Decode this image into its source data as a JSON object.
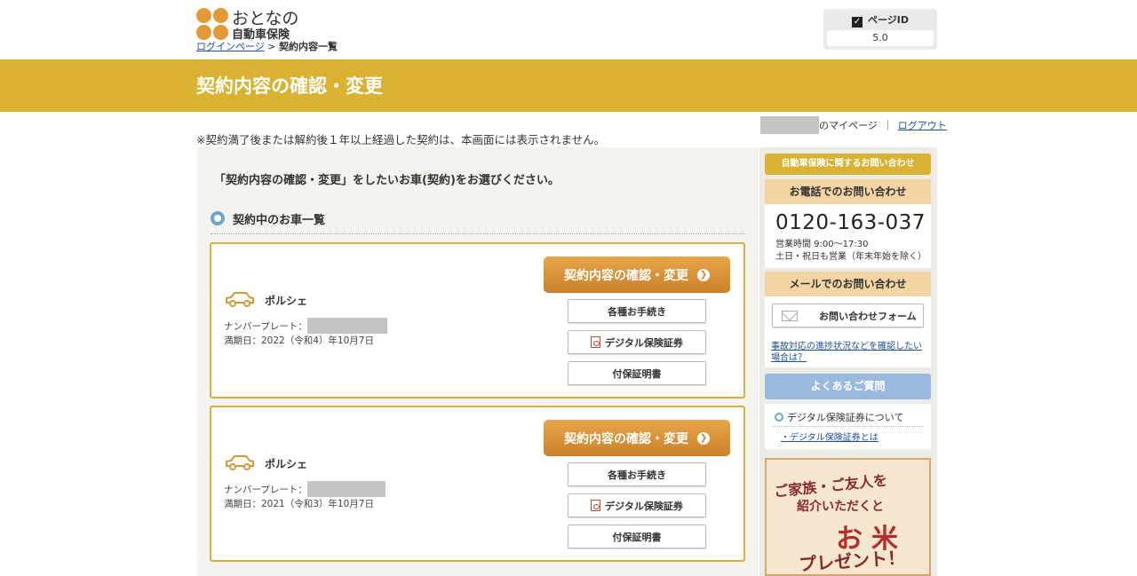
{
  "header": {
    "logo_line1": "おとなの",
    "logo_line2": "自動車保険",
    "breadcrumb_link": "ログインページ",
    "breadcrumb_sep": " > ",
    "breadcrumb_current": "契約内容一覧",
    "page_id_label": "ページID",
    "page_id_value": "5.0"
  },
  "banner": {
    "title": "契約内容の確認・変更"
  },
  "userbar": {
    "mypage_suffix": "のマイページ",
    "separator": "｜",
    "logout": "ログアウト"
  },
  "notice": "※契約満了後または解約後１年以上経過した契約は、本画面には表示されません。",
  "main": {
    "lead": "「契約内容の確認・変更」をしたいお車(契約)をお選びください。",
    "section_title": "契約中のお車一覧",
    "cars": [
      {
        "name": "ポルシェ",
        "plate_label": "ナンバープレート：",
        "expiry": "満期日：2022（令和4）年10月7日",
        "main_button": "契約内容の確認・変更",
        "btn_procedures": "各種お手続き",
        "btn_digital": "デジタル保険証券",
        "btn_certificate": "付保証明書"
      },
      {
        "name": "ポルシェ",
        "plate_label": "ナンバープレート：",
        "expiry": "満期日：2021（令和3）年10月7日",
        "main_button": "契約内容の確認・変更",
        "btn_procedures": "各種お手続き",
        "btn_digital": "デジタル保険証券",
        "btn_certificate": "付保証明書"
      }
    ]
  },
  "sidebar": {
    "contact_title": "自動車保険に関するお問い合わせ",
    "phone_head": "お電話でのお問い合わせ",
    "phone_number": "0120-163-037",
    "hours_line1": "営業時間 9:00～17:30",
    "hours_line2": "土日・祝日も営業（年末年始を除く）",
    "mail_head": "メールでのお問い合わせ",
    "mail_button": "お問い合わせフォーム",
    "accident_link": "事故対応の進捗状況などを確認したい場合は？",
    "faq_button": "よくあるご質問",
    "faq_question": "デジタル保険証券について",
    "faq_answer": "・デジタル保険証券とは",
    "promo_line1": "ご家族・ご友人を",
    "promo_line2": "紹介いただくと",
    "promo_line3": "お米",
    "promo_line4": "プレゼント！"
  },
  "colors": {
    "brand_gold": "#d9b232",
    "button_orange": "#d8923a",
    "logo_orange": "#e39a35",
    "faq_blue": "#9bb8de",
    "link_blue": "#1a4f9c"
  }
}
